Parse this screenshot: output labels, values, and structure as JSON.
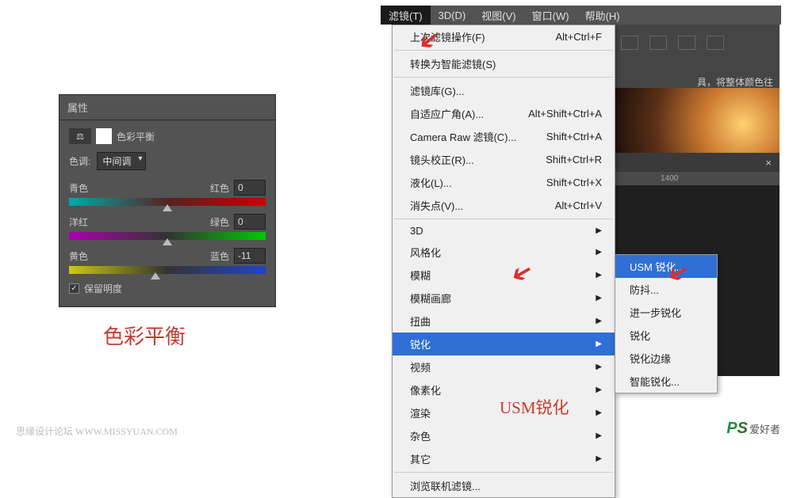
{
  "props_panel": {
    "tab": "属性",
    "title": "色彩平衡",
    "tone_label": "色调:",
    "tone_value": "中间调",
    "sliders": [
      {
        "left": "青色",
        "right": "红色",
        "value": "0",
        "grad": "grad-cr",
        "pos": 50
      },
      {
        "left": "洋红",
        "right": "绿色",
        "value": "0",
        "grad": "grad-mg",
        "pos": 50
      },
      {
        "left": "黄色",
        "right": "蓝色",
        "value": "-11",
        "grad": "grad-yb",
        "pos": 44
      }
    ],
    "preserve": "保留明度"
  },
  "captions": {
    "left": "色彩平衡",
    "right": "USM锐化"
  },
  "watermarks": {
    "left": "思缘设计论坛   WWW.MISSYUAN.COM",
    "right_prefix": "PS",
    "right_text": "爱好者"
  },
  "menubar": [
    "滤镜(T)",
    "3D(D)",
    "视图(V)",
    "窗口(W)",
    "帮助(H)"
  ],
  "dropdown": [
    {
      "label": "上次滤镜操作(F)",
      "shortcut": "Alt+Ctrl+F",
      "sep_after": true
    },
    {
      "label": "转换为智能滤镜(S)",
      "sep_after": true
    },
    {
      "label": "滤镜库(G)..."
    },
    {
      "label": "自适应广角(A)...",
      "shortcut": "Alt+Shift+Ctrl+A"
    },
    {
      "label": "Camera Raw 滤镜(C)...",
      "shortcut": "Shift+Ctrl+A"
    },
    {
      "label": "镜头校正(R)...",
      "shortcut": "Shift+Ctrl+R"
    },
    {
      "label": "液化(L)...",
      "shortcut": "Shift+Ctrl+X"
    },
    {
      "label": "消失点(V)...",
      "shortcut": "Alt+Ctrl+V",
      "sep_after": true
    },
    {
      "label": "3D",
      "arrow": true
    },
    {
      "label": "风格化",
      "arrow": true
    },
    {
      "label": "模糊",
      "arrow": true
    },
    {
      "label": "模糊画廊",
      "arrow": true
    },
    {
      "label": "扭曲",
      "arrow": true
    },
    {
      "label": "锐化",
      "arrow": true,
      "highlight": true
    },
    {
      "label": "视频",
      "arrow": true
    },
    {
      "label": "像素化",
      "arrow": true
    },
    {
      "label": "渲染",
      "arrow": true
    },
    {
      "label": "杂色",
      "arrow": true
    },
    {
      "label": "其它",
      "arrow": true,
      "sep_after": true
    },
    {
      "label": "浏览联机滤镜..."
    }
  ],
  "submenu": [
    {
      "label": "USM 锐化...",
      "highlight": true
    },
    {
      "label": "防抖..."
    },
    {
      "label": "进一步锐化"
    },
    {
      "label": "锐化"
    },
    {
      "label": "锐化边缘"
    },
    {
      "label": "智能锐化..."
    }
  ],
  "bg": {
    "hint": "具，将整体颜色往",
    "ruler": "1400",
    "close": "×"
  }
}
